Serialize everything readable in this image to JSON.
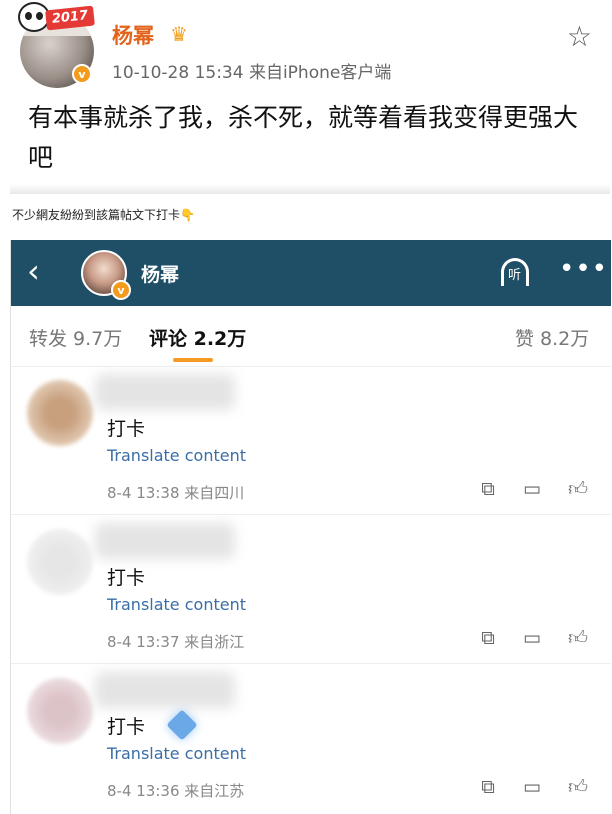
{
  "post": {
    "avatar_badge": "2017",
    "author": "杨幂",
    "crown_icon": "crown-icon",
    "verified_mark": "v",
    "meta": "10-10-28 15:34  来自iPhone客户端",
    "text": "有本事就杀了我，杀不死，就等着看我变得更强大吧",
    "star_icon": "star-outline-icon"
  },
  "caption": "不少網友紛紛到該篇帖文下打卡👇",
  "screenshot": {
    "nav": {
      "back_icon": "‹",
      "name": "杨幂",
      "listen_label": "听",
      "more_icon": "•••",
      "verified_mark": "v"
    },
    "tabs": {
      "repost": "转发 9.7万",
      "comments": "评论 2.2万",
      "likes": "赞 8.2万",
      "accent_color": "#f59a23"
    },
    "comments": [
      {
        "text": "打卡",
        "translate": "Translate content",
        "meta": "8-4 13:38  来自四川",
        "avatar_color": "#c8a07e"
      },
      {
        "text": "打卡",
        "translate": "Translate content",
        "meta": "8-4 13:37  来自浙江",
        "avatar_color": "#e6e6e6"
      },
      {
        "text": "打卡",
        "translate": "Translate content",
        "meta": "8-4 13:36  来自江苏",
        "avatar_color": "#dcc3c8"
      }
    ],
    "action_icons": [
      "share-icon",
      "comment-icon",
      "like-icon"
    ]
  }
}
